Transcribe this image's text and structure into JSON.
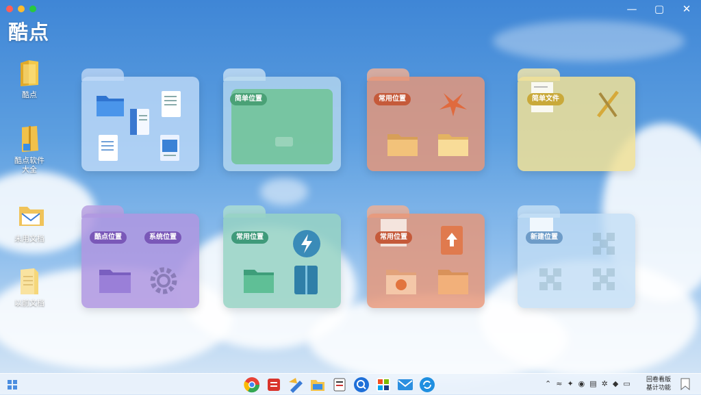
{
  "window": {
    "title": "酷点",
    "controls": {
      "minimize": "—",
      "maximize": "▢",
      "close": "✕"
    }
  },
  "desktop_icons": [
    {
      "label": "酷点",
      "icon": "folder-icon"
    },
    {
      "label": "酷点软件\n大全",
      "icon": "folder-zipper-icon"
    },
    {
      "label": "未用文档",
      "icon": "mail-folder-icon"
    },
    {
      "label": "以前文档",
      "icon": "document-folder-icon"
    }
  ],
  "folders": [
    {
      "id": "docs",
      "color": "blue",
      "label": ""
    },
    {
      "id": "green1",
      "color": "green",
      "label": "简单位置"
    },
    {
      "id": "orange1",
      "color": "orange",
      "label": "常用位置"
    },
    {
      "id": "yellow1",
      "color": "yellow",
      "label": "简单文件"
    },
    {
      "id": "purple1",
      "color": "purple",
      "label": "酷点位置",
      "label2": "系统位置"
    },
    {
      "id": "green2",
      "color": "teal",
      "label": "常用位置"
    },
    {
      "id": "orange2",
      "color": "orange",
      "label": "常用位置"
    },
    {
      "id": "lightblue1",
      "color": "lightblue",
      "label": "新建位置"
    }
  ],
  "taskbar": {
    "start_icon": "windows-start-icon",
    "apps": [
      "chrome-icon",
      "news-app-icon",
      "pen-tool-icon",
      "file-explorer-icon",
      "notes-icon",
      "browser-search-icon",
      "store-icon",
      "mail-icon",
      "sync-icon"
    ],
    "tray_icons": [
      "chevron-up-icon",
      "wifi-icon",
      "pin-icon",
      "eye-icon",
      "network-icon",
      "settings-icon",
      "speaker-icon",
      "keyboard-icon"
    ],
    "clock_line1": "回卷看版",
    "clock_line2": "基计功能"
  }
}
